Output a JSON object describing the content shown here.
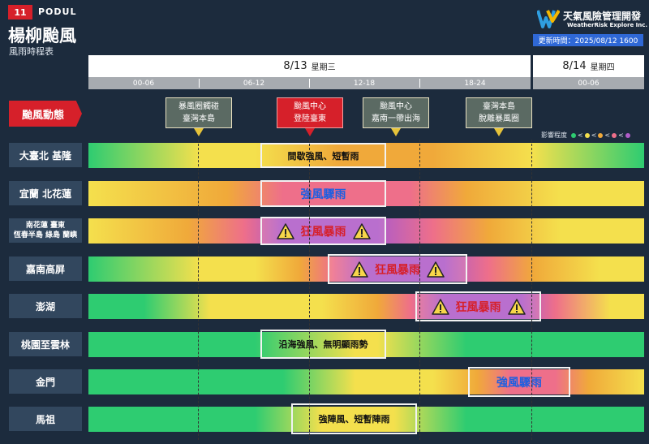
{
  "header": {
    "storm_number": "11",
    "storm_name_en": "PODUL",
    "title": "楊柳颱風",
    "subtitle": "風雨時程表",
    "brand_zh": "天氣風險管理開發",
    "brand_en": "WeatherRisk Explore Inc.",
    "update_time": "更新時間：2025/08/12 1600"
  },
  "timeline": {
    "dates": [
      {
        "date": "8/13",
        "weekday": "星期三"
      },
      {
        "date": "8/14",
        "weekday": "星期四"
      }
    ],
    "slots": [
      "00-06",
      "06-12",
      "12-18",
      "18-24",
      "00-06"
    ]
  },
  "status": {
    "label": "颱風動態",
    "events": [
      {
        "line1": "暴風圈觸碰",
        "line2": "臺灣本島"
      },
      {
        "line1": "颱風中心",
        "line2": "登陸臺東"
      },
      {
        "line1": "颱風中心",
        "line2": "嘉南一帶出海"
      },
      {
        "line1": "臺灣本島",
        "line2": "脫離暴風圈"
      }
    ]
  },
  "legend": {
    "label": "影響程度",
    "colors": [
      "#2ecc71",
      "#f4e04d",
      "#f0a93a",
      "#ee6f8a",
      "#b05cc8"
    ]
  },
  "rows": [
    {
      "region": "大臺北 基隆",
      "note": "間歇強風、短暫雨"
    },
    {
      "region": "宜蘭 北花蓮",
      "note": "強風驟雨"
    },
    {
      "region_line1": "南花蓮 臺東",
      "region_line2": "恆春半島 綠島 蘭嶼",
      "note": "狂風暴雨"
    },
    {
      "region": "嘉南高屏",
      "note": "狂風暴雨"
    },
    {
      "region": "澎湖",
      "note": "狂風暴雨"
    },
    {
      "region": "桃園至雲林",
      "note": "沿海強風、無明顯雨勢"
    },
    {
      "region": "金門",
      "note": "強風驟雨"
    },
    {
      "region": "馬祖",
      "note": "強陣風、短暫陣雨"
    }
  ],
  "icons": {
    "warning": "warning-triangle-icon",
    "logo": "weatherrisk-logo"
  }
}
